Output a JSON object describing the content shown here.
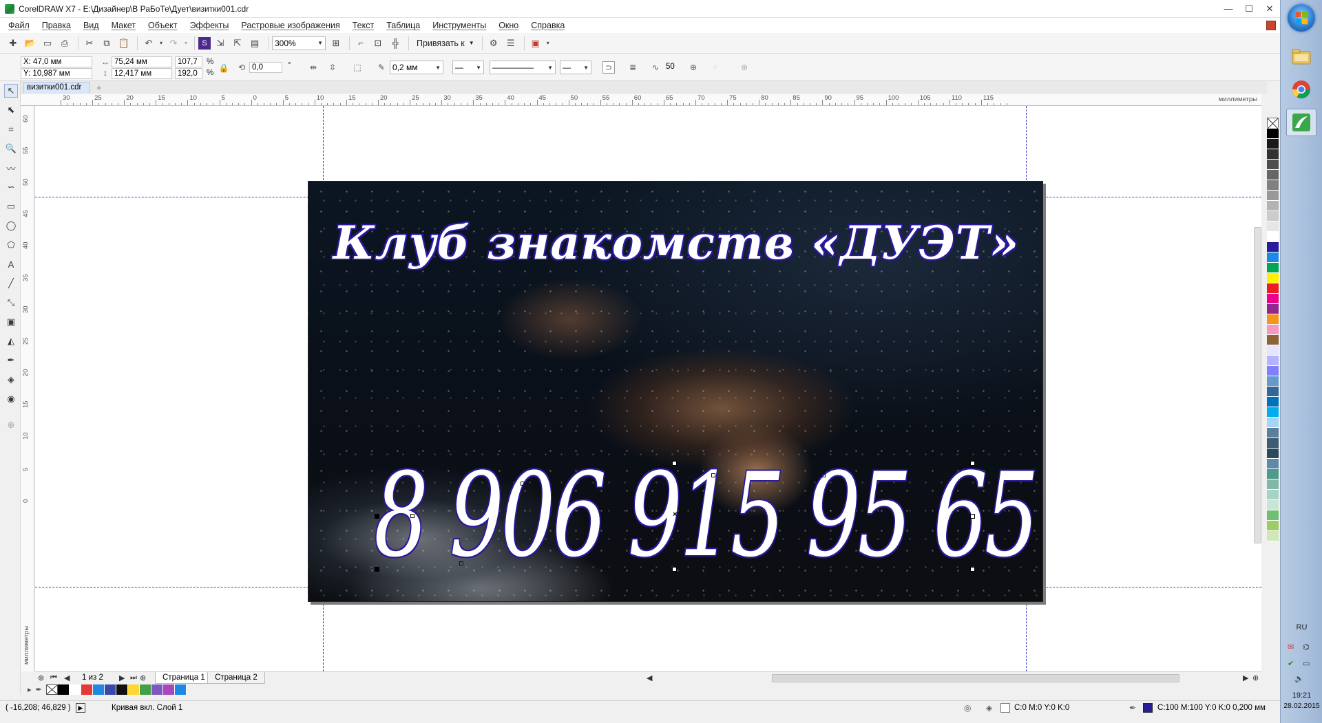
{
  "window": {
    "title": "CorelDRAW X7 - E:\\Дизайнер\\В РаБоТе\\Дует\\визитки001.cdr",
    "controls": {
      "minimize": "—",
      "maximize": "☐",
      "close": "✕"
    }
  },
  "menu": [
    "Файл",
    "Правка",
    "Вид",
    "Макет",
    "Объект",
    "Эффекты",
    "Растровые изображения",
    "Текст",
    "Таблица",
    "Инструменты",
    "Окно",
    "Справка"
  ],
  "toolbar": {
    "zoom": "300%",
    "snap_label": "Привязать к"
  },
  "propbar": {
    "x": "X: 47,0 мм",
    "y": "Y: 10,987 мм",
    "width": "75,24 мм",
    "height": "12,417 мм",
    "scale_x": "107,7",
    "scale_y": "192,0",
    "pct1": "%",
    "pct2": "%",
    "rotation": "0,0",
    "deg": "°",
    "outline_width": "0,2 мм",
    "smoothing": "50"
  },
  "document": {
    "tab": "визитки001.cdr"
  },
  "ruler": {
    "top_labels": [
      "30",
      "25",
      "20",
      "15",
      "10",
      "5",
      "0",
      "5",
      "10",
      "15",
      "20",
      "25",
      "30",
      "35",
      "40",
      "45",
      "50",
      "55",
      "60",
      "65",
      "70",
      "75",
      "80",
      "85",
      "90",
      "95",
      "100",
      "105",
      "110",
      "115"
    ],
    "left_labels": [
      "60",
      "55",
      "50",
      "45",
      "40",
      "35",
      "30",
      "25",
      "20",
      "15",
      "10",
      "5",
      "0"
    ],
    "unit": "миллиметры"
  },
  "card": {
    "title": "Клуб знакомств «ДУЭТ»",
    "phone": "8 906 915 95 65",
    "outline_color": "#2a1a9c"
  },
  "pages": {
    "counter": "1 из 2",
    "tabs": [
      "Страница 1",
      "Страница 2"
    ]
  },
  "palette_bottom": [
    "#000000",
    "#ffffff",
    "#e53935",
    "#1e88e5",
    "#3949ab",
    "#111111",
    "#fdd835",
    "#43a047",
    "#7e57c2",
    "#ab47bc",
    "#1e88e5"
  ],
  "palette_right": [
    "#000000",
    "#1a1a1a",
    "#333333",
    "#4d4d4d",
    "#666666",
    "#808080",
    "#999999",
    "#b3b3b3",
    "#cccccc",
    "#e6e6e6",
    "#ffffff",
    "#2a1a9c",
    "#1e88e5",
    "#00a651",
    "#fff200",
    "#ed1c24",
    "#ec008c",
    "#92278f",
    "#f7941d",
    "#f49ac1",
    "#8c6239",
    "#e5e5ff",
    "#b3b3ff",
    "#7f7fff",
    "#6699cc",
    "#336699",
    "#0072bc",
    "#00aeef",
    "#a3d6f5",
    "#5a7f9c",
    "#3d5b73",
    "#2b4a5e",
    "#5d8aa8",
    "#4f9a8a",
    "#7fb8a8",
    "#a7d3c4",
    "#c8e6d7",
    "#6fbf73",
    "#9ccc65",
    "#cfe8b5"
  ],
  "status": {
    "coords": "( -16,208; 46,829 )",
    "object": "Кривая вкл. Слой 1",
    "fill": "C:0 M:0 Y:0 K:0",
    "outline": "C:100 M:100 Y:0 K:0  0,200 мм"
  },
  "taskbar": {
    "lang": "RU",
    "time": "19:21",
    "date": "28.02.2015"
  }
}
